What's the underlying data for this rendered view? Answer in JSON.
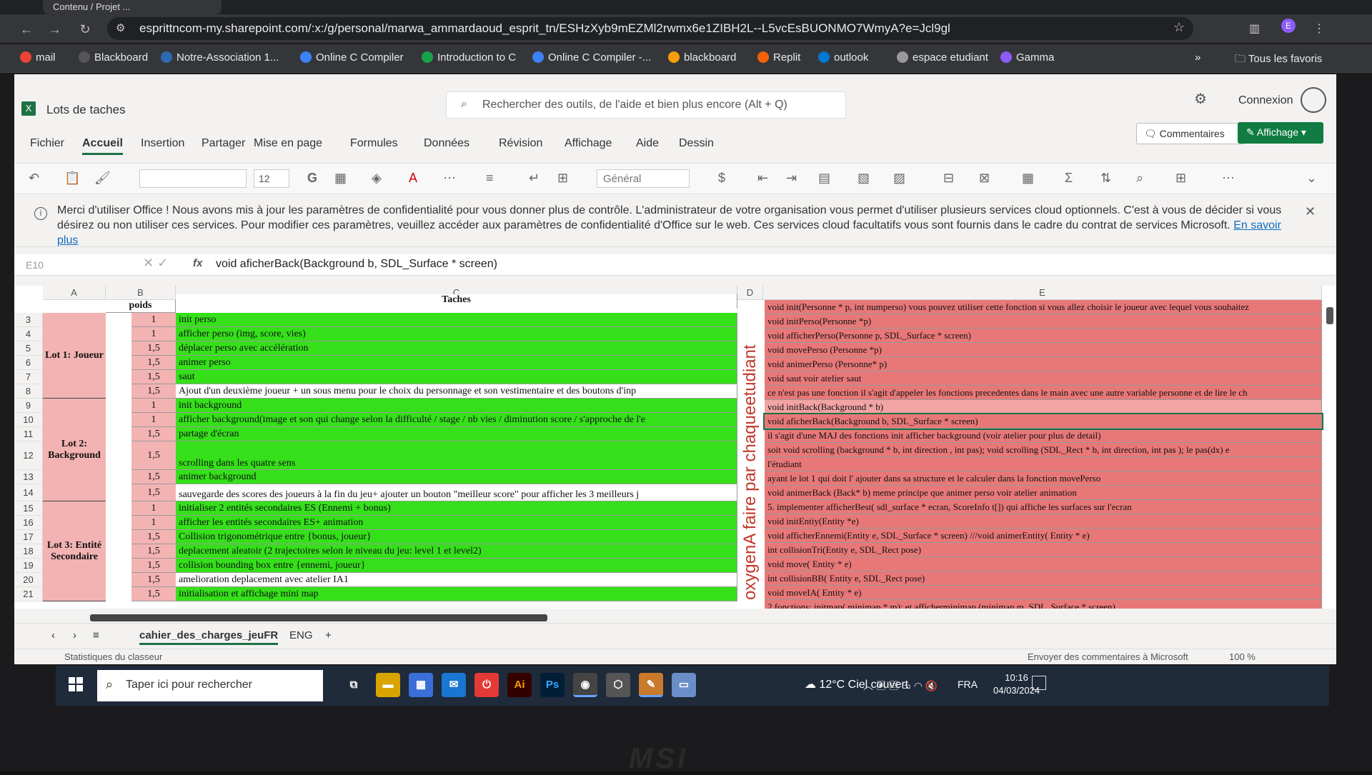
{
  "browser": {
    "tab_title": "Contenu / Projet ...",
    "url": "esprittncom-my.sharepoint.com/:x:/g/personal/marwa_ammardaoud_esprit_tn/ESHzXyb9mEZMl2rwmx6e1ZIBH2L--L5vcEsBUONMO7WmyA?e=Jcl9gl",
    "profile_initial": "E",
    "bookmarks": [
      "mail",
      "Blackboard",
      "Notre-Association 1...",
      "Online C Compiler",
      "Introduction to C",
      "Online C Compiler -...",
      "blackboard",
      "Replit",
      "outlook",
      "espace etudiant",
      "Gamma"
    ],
    "bookmarks_more": "»",
    "all_favorites": "Tous les favoris",
    "colors": {
      "mail": "#ea4335",
      "Blackboard": "#555555",
      "Notre-Association 1...": "#2b6cb0",
      "Online C Compiler": "#3b82f6",
      "Introduction to C": "#16a34a",
      "Online C Compiler -...": "#3b82f6",
      "blackboard": "#f59e0b",
      "Replit": "#f26207",
      "outlook": "#0078d4",
      "espace etudiant": "#999999",
      "Gamma": "#8b5cf6"
    }
  },
  "excel": {
    "doc_name": "Lots de taches",
    "search_placeholder": "Rechercher des outils, de l'aide et bien plus encore (Alt + Q)",
    "connexion": "Connexion",
    "menu": [
      "Fichier",
      "Accueil",
      "Insertion",
      "Partager",
      "Mise en page",
      "Formules",
      "Données",
      "Révision",
      "Affichage",
      "Aide",
      "Dessin"
    ],
    "active_menu": "Accueil",
    "comments_label": "Commentaires",
    "view_label": "Affichage",
    "font_size": "12",
    "number_format": "Général",
    "notice_text": "Merci d'utiliser Office ! Nous avons mis à jour les paramètres de confidentialité pour vous donner plus de contrôle. L'administrateur de votre organisation vous permet d'utiliser plusieurs services cloud optionnels. C'est à vous de décider si vous désirez ou non utiliser ces services. Pour modifier ces paramètres, veuillez accéder aux paramètres de confidentialité d'Office sur le web. Ces services cloud facultatifs vous sont fournis dans le cadre du contrat de services Microsoft.",
    "notice_link": "En savoir plus",
    "namebox": "E10",
    "formula": "void aficherBack(Background b, SDL_Surface * screen)",
    "columns": [
      "A",
      "B",
      "C",
      "D",
      "E"
    ],
    "header_poids": "poids",
    "header_taches": "Taches",
    "lots": [
      "Lot 1: Joueur",
      "Lot 2: Background",
      "Lot 3: Entité Secondaire"
    ],
    "vertical_text": "oxygenA faire par chaqueetudiant",
    "rows": [
      {
        "num": "3",
        "w": "1",
        "task": "init perso",
        "e": "void init(Personne * p, int numperso) vous pouvez utiliser cette fonction si vous allez choisir le joueur avec lequel vous souhaitez"
      },
      {
        "num": "4",
        "w": "1",
        "task": "afficher perso (img, score, vies)",
        "e": "void initPerso(Personne *p)"
      },
      {
        "num": "5",
        "w": "1,5",
        "task": "déplacer perso avec accélération",
        "e": "void afficherPerso(Personne p, SDL_Surface * screen)"
      },
      {
        "num": "6",
        "w": "1,5",
        "task": "animer perso",
        "e": "void movePerso (Personne *p)"
      },
      {
        "num": "7",
        "w": "1,5",
        "task": "saut",
        "e": "void animerPerso (Personne* p)"
      },
      {
        "num": "8",
        "w": "1,5",
        "task": "Ajout d'un deuxième joueur + un sous menu pour le choix du personnage et son vestimentaire et des boutons d'inp",
        "e": "void saut voir atelier saut"
      },
      {
        "num": "9",
        "w": "1",
        "task": "init background",
        "e": "ce n'est pas une fonction il s'agit d'appeler les fonctions precedentes dans le main avec une autre variable personne et de lire le ch"
      },
      {
        "num": "10",
        "w": "1",
        "task": "afficher background(image et son qui change selon la difficulté / stage / nb vies / diminution score / s'approche de l'e",
        "e": "void initBack(Background * b)"
      },
      {
        "num": "11",
        "w": "1,5",
        "task": "partage d'écran",
        "e": "void aficherBack(Background b, SDL_Surface * screen)"
      },
      {
        "num": "12",
        "w": "1,5",
        "task": "scrolling dans les quatre sens",
        "e": "il s'agit d'une MAJ des fonctions init afficher background (voir atelier pour plus de detail)"
      },
      {
        "num": "13",
        "w": "1,5",
        "task": "animer background",
        "e": "soit void scrolling (background * b, int direction , int pas); void scrolling (SDL_Rect * b, int direction, int pas ); le pas(dx) e"
      },
      {
        "num": "14",
        "w": "1,5",
        "task": "sauvegarde des scores des joueurs à la fin du jeu+ ajouter un bouton \"meilleur score\" pour afficher les 3 meilleurs j",
        "e": "l'étudiant"
      },
      {
        "num": "15",
        "w": "1",
        "task": "initialiser 2 entités secondaires ES (Ennemi + bonus)",
        "e": "ayant le lot 1 qui doit l' ajouter dans sa structure et le calculer dans la fonction movePerso"
      },
      {
        "num": "16",
        "w": "1",
        "task": "afficher les entités secondaires ES+ animation",
        "e": "void animerBack (Back* b) meme principe que animer perso voir atelier animation"
      },
      {
        "num": "17",
        "w": "1,5",
        "task": "Collision trigonométrique entre {bonus, joueur}",
        "e": "5. implementer afficherBest( sdl_surface * ecran, ScoreInfo t[]) qui affiche les surfaces sur l'ecran"
      },
      {
        "num": "18",
        "w": "1,5",
        "task": "deplacement aleatoir (2 trajectoires selon le niveau du jeu: level 1 et level2)",
        "e": "void initEntiy(Entity *e)"
      },
      {
        "num": "19",
        "w": "1,5",
        "task": "collision bounding box entre {ennemi, joueur}",
        "e": "void afficherEnnemi(Entity e, SDL_Surface  * screen) ///void animerEntity( Entity * e)"
      },
      {
        "num": "20",
        "w": "1,5",
        "task": "amelioration deplacement avec  atelier IA1",
        "e": "int collisionTri(Entity e,  SDL_Rect pose)"
      },
      {
        "num": "21",
        "w": "1,5",
        "task": "initialisation et affichage mini map",
        "e": "void move( Entity * e)"
      }
    ],
    "e_extra": [
      "int collisionBB( Entity e,  SDL_Rect pose)",
      "void moveIA( Entity * e)",
      "2 fonctions:  initmap( minimap * m); et afficherminimap (minimap m, SDL_Surface * screen)"
    ],
    "sheets": [
      "cahier_des_charges_jeuFR",
      "ENG"
    ],
    "active_sheet": "cahier_des_charges_jeuFR",
    "status_left": "Statistiques du classeur",
    "status_feedback": "Envoyer des commentaires à Microsoft",
    "zoom": "100 %"
  },
  "taskbar": {
    "search_placeholder": "Taper ici pour rechercher",
    "weather": "12°C  Ciel couvert",
    "lang": "FRA",
    "time": "10:16",
    "date": "04/03/2024",
    "apps": [
      "Ai",
      "Ps"
    ]
  },
  "bezel": "MSI"
}
